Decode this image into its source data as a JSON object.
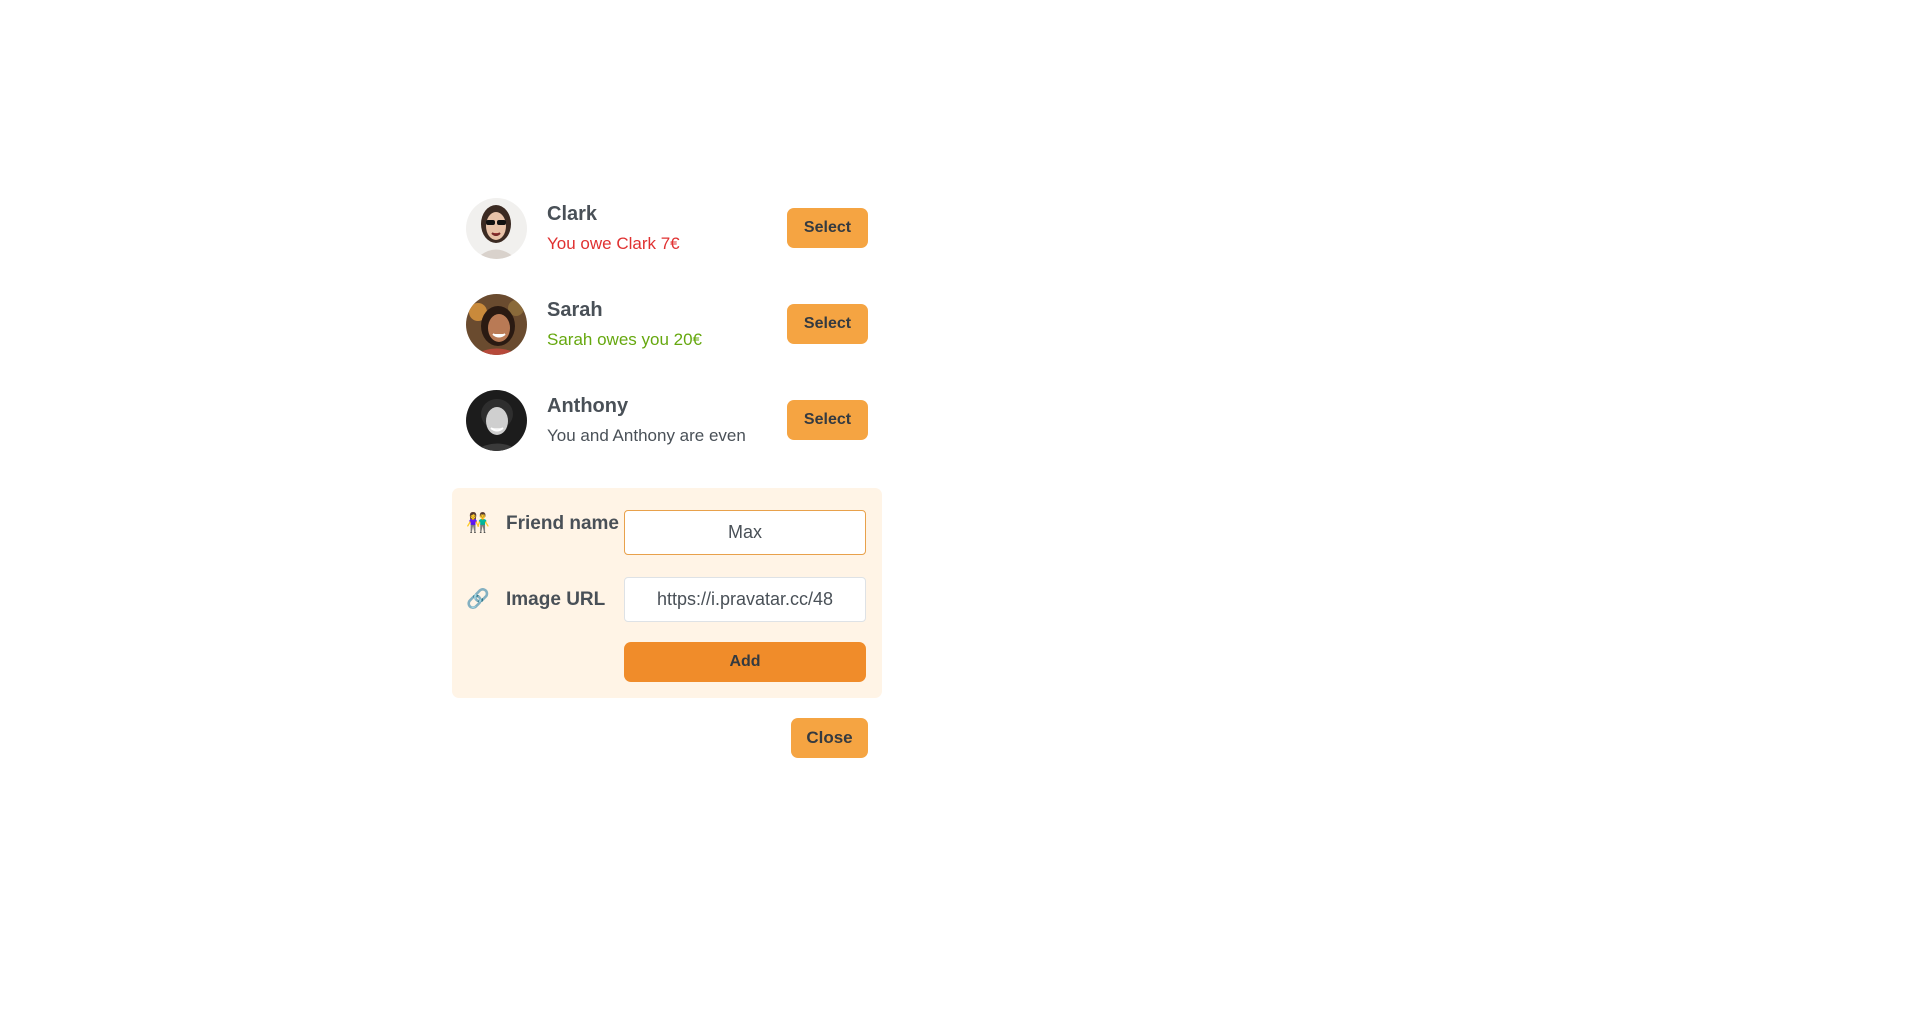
{
  "friends": [
    {
      "name": "Clark",
      "status": "You owe Clark 7€",
      "status_type": "negative",
      "avatar_icon": "avatar-clark"
    },
    {
      "name": "Sarah",
      "status": "Sarah owes you 20€",
      "status_type": "positive",
      "avatar_icon": "avatar-sarah"
    },
    {
      "name": "Anthony",
      "status": "You and Anthony are even",
      "status_type": "even",
      "avatar_icon": "avatar-anthony"
    }
  ],
  "select_label": "Select",
  "form": {
    "name_emoji": "👫",
    "name_label": "Friend name",
    "name_value": "Max",
    "url_emoji": "🔗",
    "url_label": "Image URL",
    "url_value": "https://i.pravatar.cc/48",
    "add_label": "Add"
  },
  "close_label": "Close",
  "colors": {
    "accent": "#f5a442",
    "accent_dark": "#f08c2a",
    "form_bg": "#fff4e6",
    "negative": "#e03131",
    "positive": "#66a80f"
  }
}
